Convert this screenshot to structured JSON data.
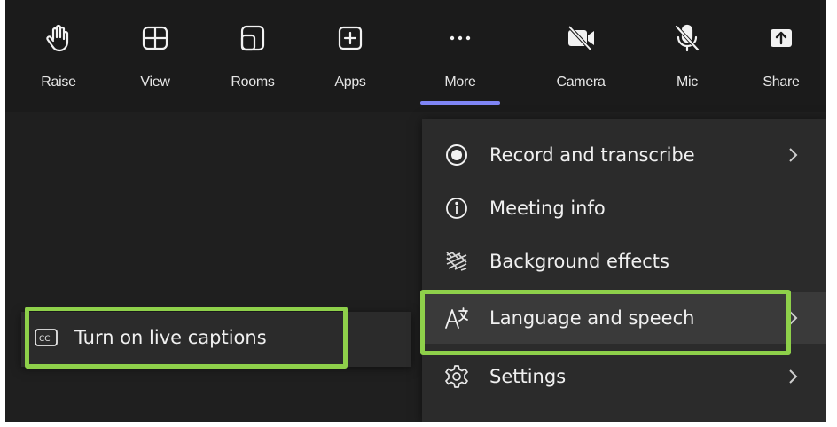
{
  "toolbar": {
    "buttons": [
      {
        "label": "Raise",
        "icon": "raise-hand-icon"
      },
      {
        "label": "View",
        "icon": "view-layout-icon"
      },
      {
        "label": "Rooms",
        "icon": "breakout-rooms-icon"
      },
      {
        "label": "Apps",
        "icon": "apps-add-icon"
      },
      {
        "label": "More",
        "icon": "more-ellipsis-icon"
      },
      {
        "label": "Camera",
        "icon": "camera-off-icon"
      },
      {
        "label": "Mic",
        "icon": "mic-off-icon"
      },
      {
        "label": "Share",
        "icon": "share-screen-icon"
      }
    ],
    "active": "More"
  },
  "more_menu": {
    "items": [
      {
        "label": "Record and transcribe",
        "icon": "record-icon",
        "has_submenu": true
      },
      {
        "label": "Meeting info",
        "icon": "info-icon",
        "has_submenu": false
      },
      {
        "label": "Background effects",
        "icon": "background-effects-icon",
        "has_submenu": false
      },
      {
        "label": "Language and speech",
        "icon": "language-icon",
        "has_submenu": true
      },
      {
        "label": "Settings",
        "icon": "gear-icon",
        "has_submenu": true
      }
    ]
  },
  "captions_menu": {
    "item": {
      "label": "Turn on live captions",
      "icon": "closed-captions-icon"
    }
  },
  "colors": {
    "background": "#1f1f1f",
    "menu": "#2b2b2b",
    "highlight_border": "#8ed04a",
    "active_underline": "#7f85f5"
  }
}
